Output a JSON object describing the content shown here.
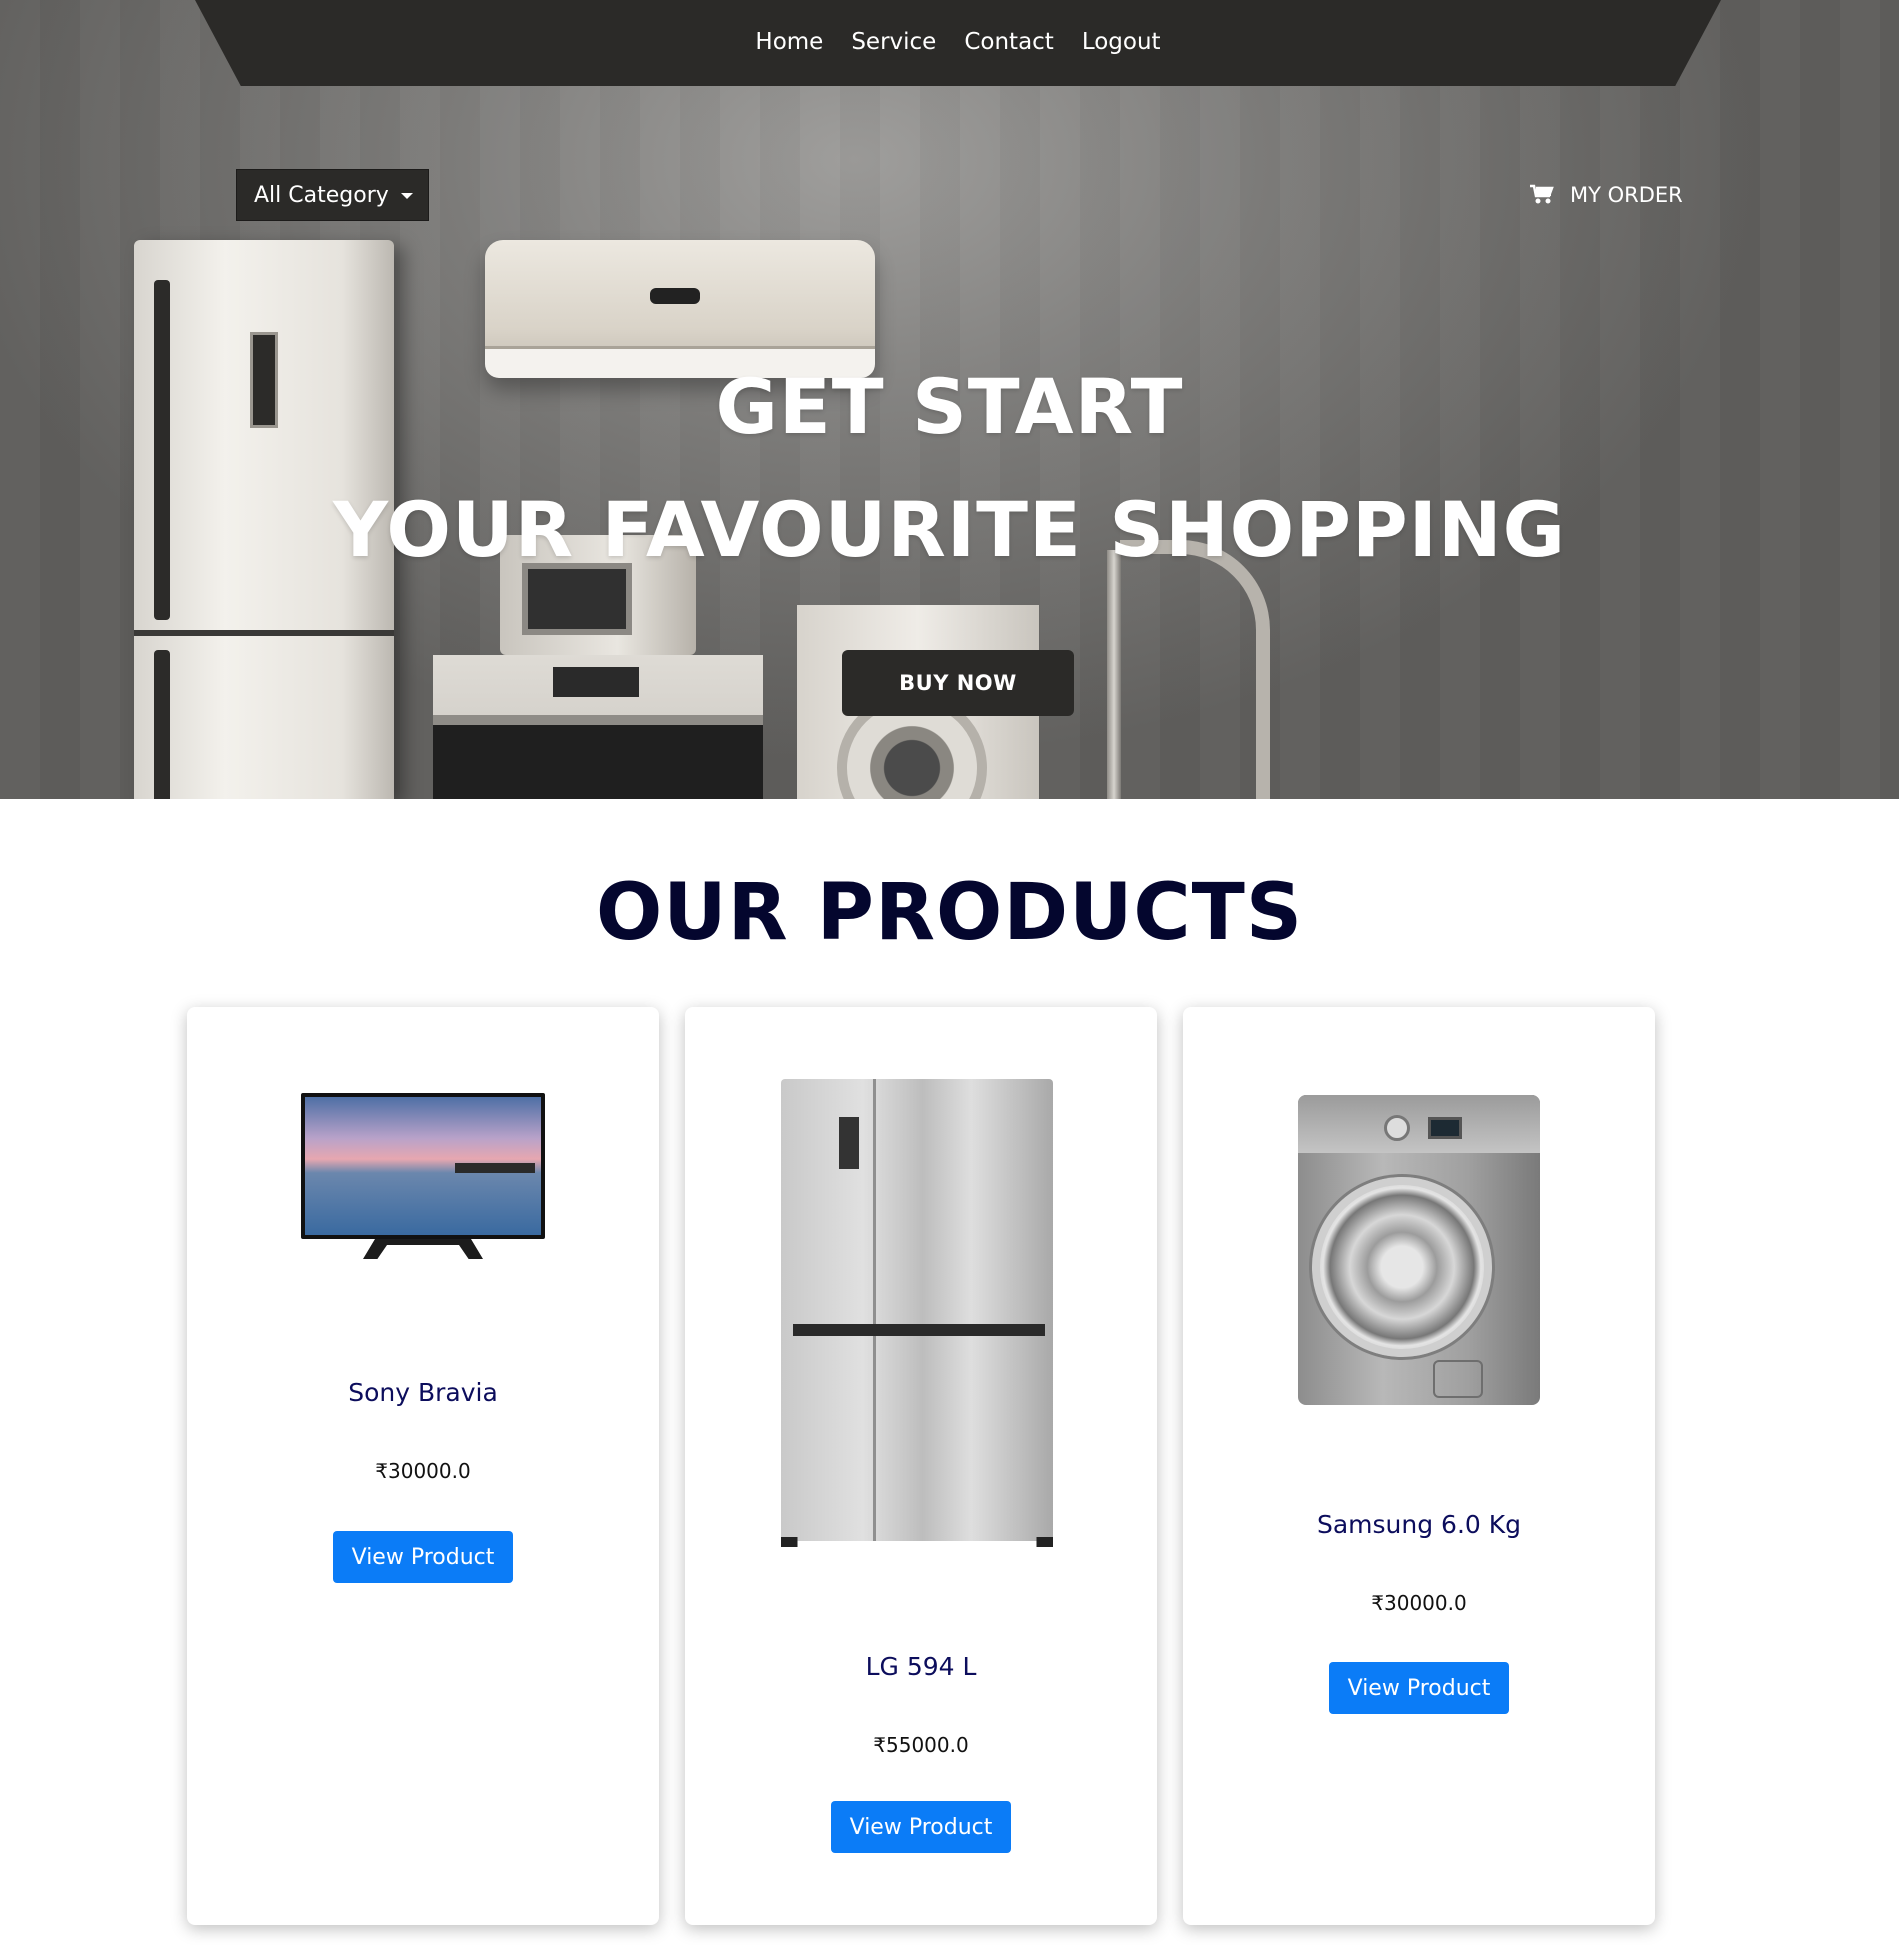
{
  "nav": {
    "links": [
      "Home",
      "Service",
      "Contact",
      "Logout"
    ]
  },
  "hero": {
    "category_button": "All Category",
    "my_order": "MY ORDER",
    "title_line1": "GET START",
    "title_line2": "YOUR FAVOURITE SHOPPING",
    "buy_button": "BUY NOW"
  },
  "products": {
    "heading": "OUR PRODUCTS",
    "items": [
      {
        "name": "Sony Bravia",
        "price": "₹30000.0",
        "button": "View Product",
        "image_icon": "tv-icon"
      },
      {
        "name": "LG 594 L",
        "price": "₹55000.0",
        "button": "View Product",
        "image_icon": "refrigerator-icon"
      },
      {
        "name": "Samsung 6.0 Kg",
        "price": "₹30000.0",
        "button": "View Product",
        "image_icon": "washing-machine-icon"
      }
    ]
  },
  "colors": {
    "nav_bg": "#2b2a28",
    "heading": "#04062e",
    "product_name": "#0c0d5c",
    "button_blue": "#0b7cf7"
  }
}
